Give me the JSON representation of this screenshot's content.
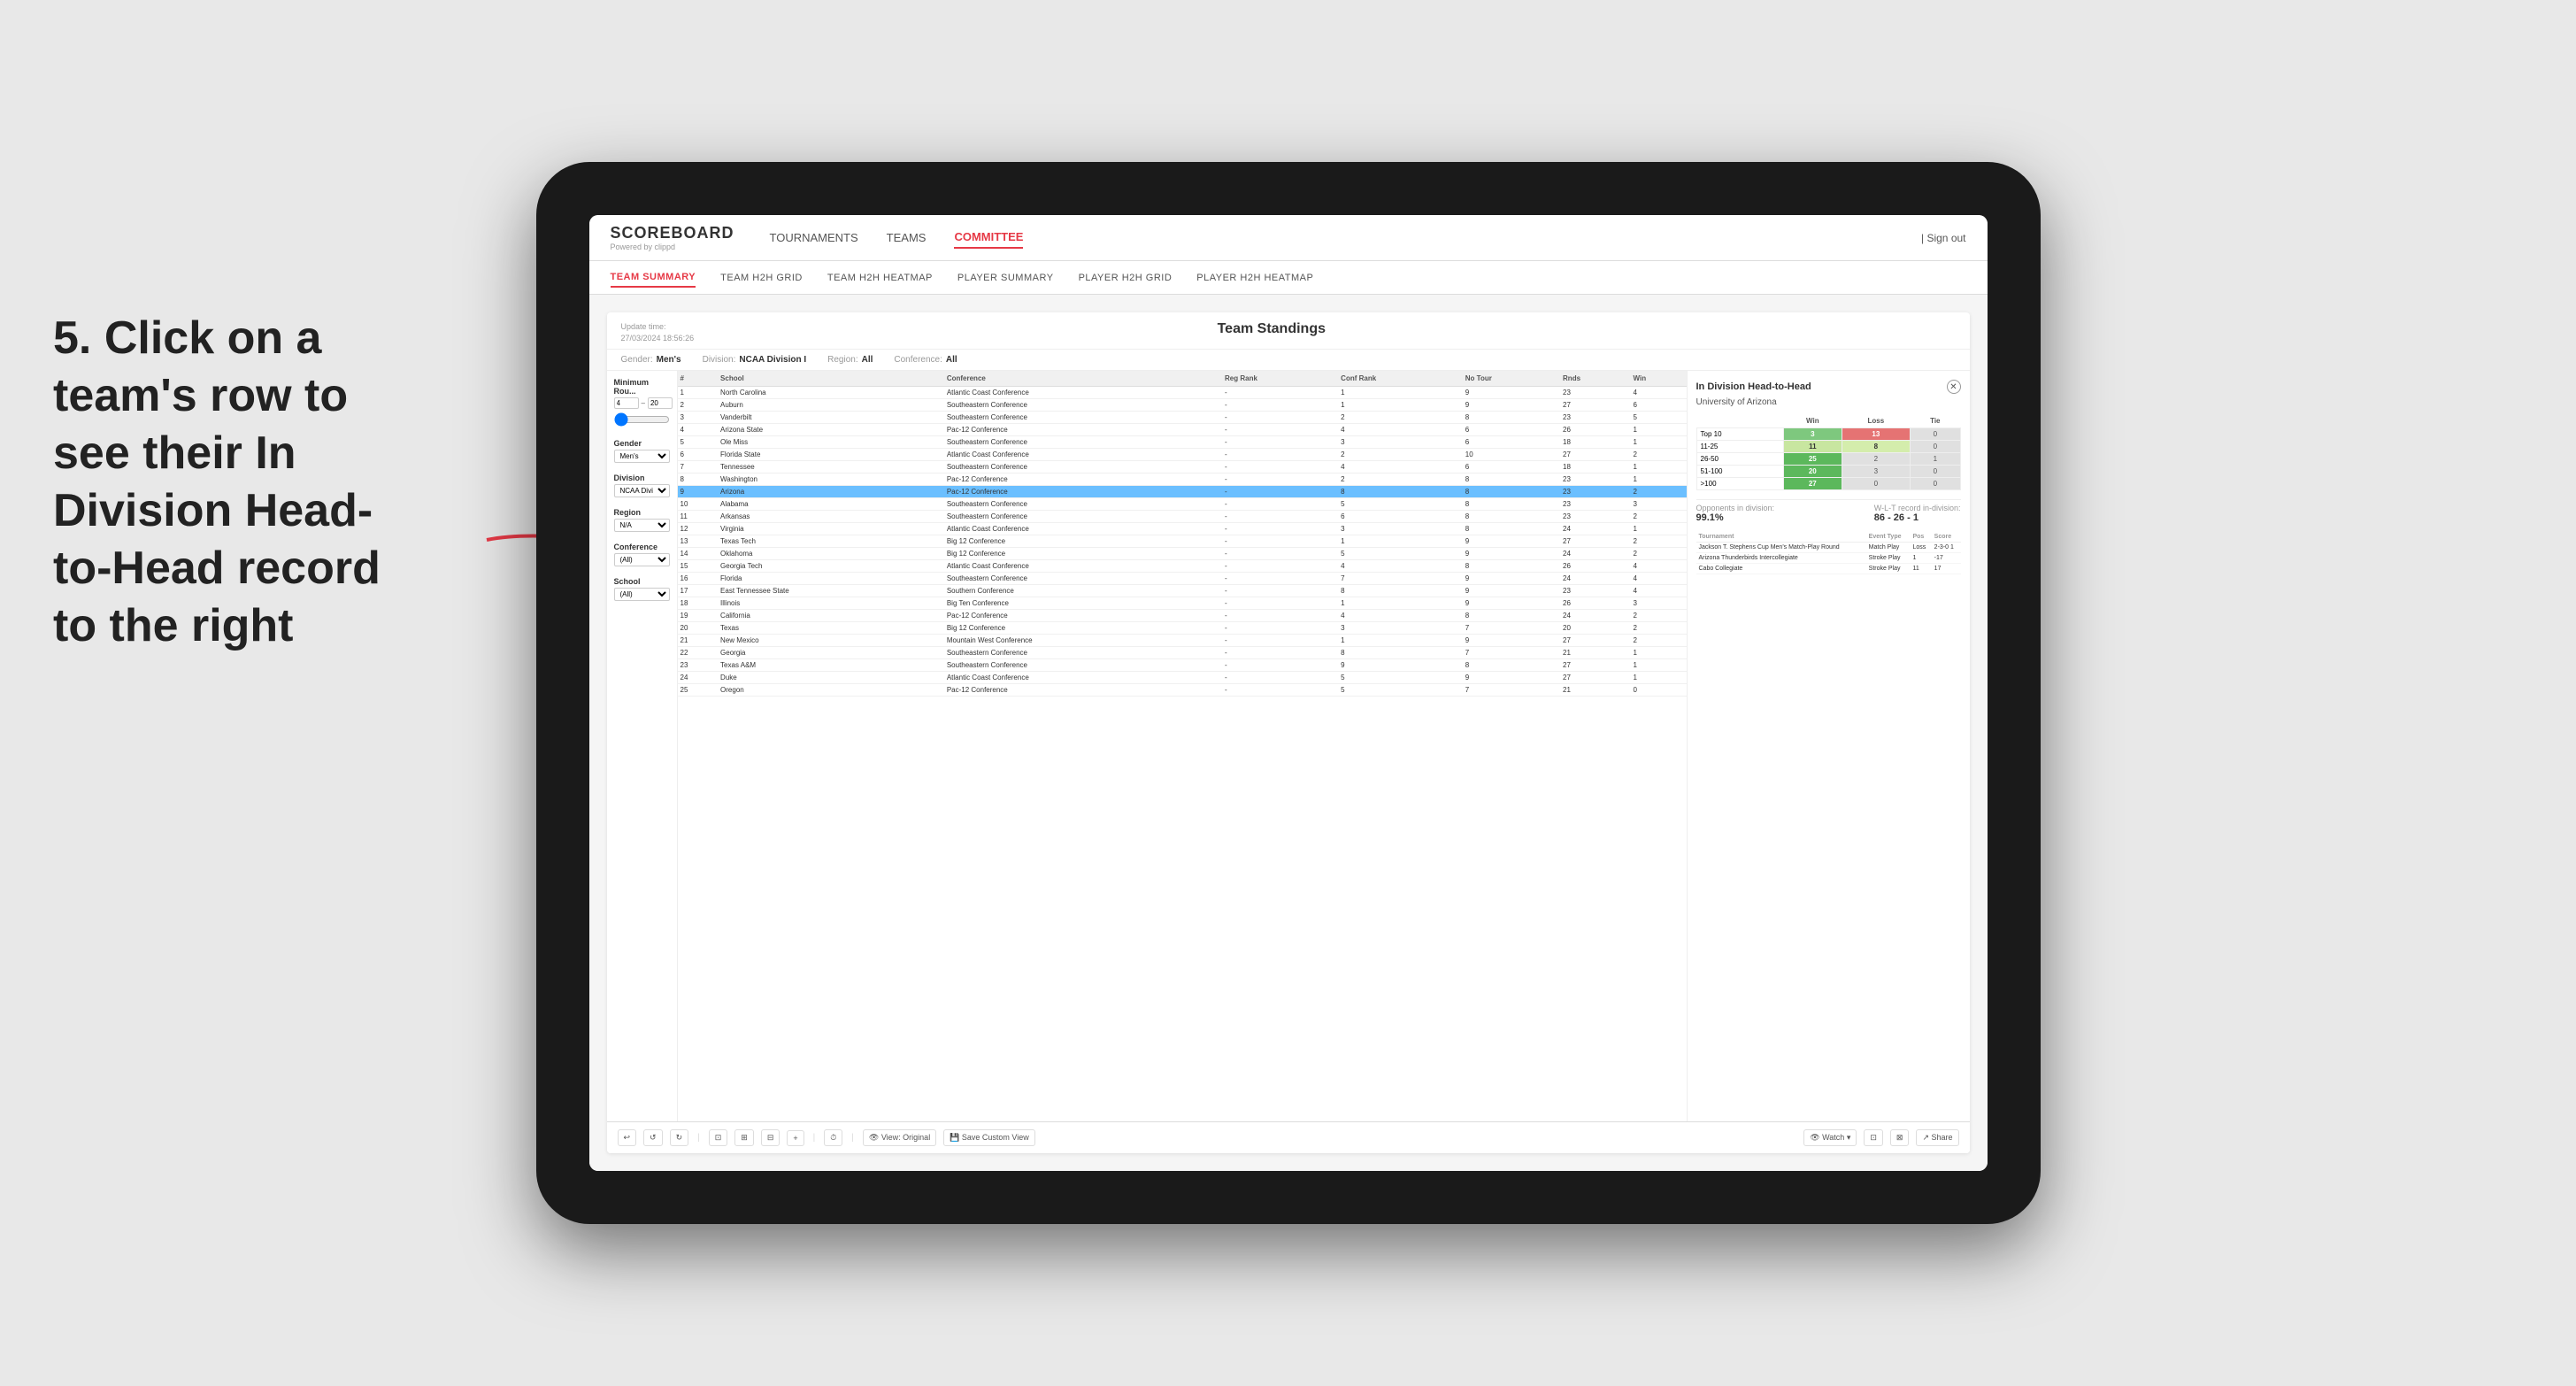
{
  "instruction": {
    "step": "5.",
    "text": "Click on a team's row to see their In Division Head-to-Head record to the right"
  },
  "nav": {
    "logo": "SCOREBOARD",
    "logo_sub": "Powered by clippd",
    "links": [
      "TOURNAMENTS",
      "TEAMS",
      "COMMITTEE"
    ],
    "active_link": "COMMITTEE",
    "sign_out": "Sign out"
  },
  "sub_nav": {
    "links": [
      "TEAM SUMMARY",
      "TEAM H2H GRID",
      "TEAM H2H HEATMAP",
      "PLAYER SUMMARY",
      "PLAYER H2H GRID",
      "PLAYER H2H HEATMAP"
    ],
    "active_link": "TEAM SUMMARY"
  },
  "panel": {
    "update_time": "Update time:\n27/03/2024 18:56:26",
    "title": "Team Standings",
    "filters": {
      "gender_label": "Gender:",
      "gender_value": "Men's",
      "division_label": "Division:",
      "division_value": "NCAA Division I",
      "region_label": "Region:",
      "region_value": "All",
      "conference_label": "Conference:",
      "conference_value": "All"
    }
  },
  "left_filters": {
    "min_rounds_label": "Minimum Rou...",
    "min_rounds_value": "4",
    "max_rounds_value": "20",
    "gender_label": "Gender",
    "gender_options": [
      "Men's"
    ],
    "division_label": "Division",
    "division_options": [
      "NCAA Division I"
    ],
    "region_label": "Region",
    "region_options": [
      "N/A"
    ],
    "conference_label": "Conference",
    "conference_options": [
      "(All)"
    ],
    "school_label": "School",
    "school_options": [
      "(All)"
    ]
  },
  "table": {
    "headers": [
      "#",
      "School",
      "Conference",
      "Reg Rank",
      "Conf Rank",
      "No Tour",
      "Rnds",
      "Win"
    ],
    "rows": [
      {
        "rank": 1,
        "school": "North Carolina",
        "conference": "Atlantic Coast Conference",
        "reg": "-",
        "conf": "1",
        "tour": "9",
        "rnds": "23",
        "win": "4",
        "highlighted": false
      },
      {
        "rank": 2,
        "school": "Auburn",
        "conference": "Southeastern Conference",
        "reg": "-",
        "conf": "1",
        "tour": "9",
        "rnds": "27",
        "win": "6",
        "highlighted": false
      },
      {
        "rank": 3,
        "school": "Vanderbilt",
        "conference": "Southeastern Conference",
        "reg": "-",
        "conf": "2",
        "tour": "8",
        "rnds": "23",
        "win": "5",
        "highlighted": false
      },
      {
        "rank": 4,
        "school": "Arizona State",
        "conference": "Pac-12 Conference",
        "reg": "-",
        "conf": "4",
        "tour": "6",
        "rnds": "26",
        "win": "1",
        "highlighted": false
      },
      {
        "rank": 5,
        "school": "Ole Miss",
        "conference": "Southeastern Conference",
        "reg": "-",
        "conf": "3",
        "tour": "6",
        "rnds": "18",
        "win": "1",
        "highlighted": false
      },
      {
        "rank": 6,
        "school": "Florida State",
        "conference": "Atlantic Coast Conference",
        "reg": "-",
        "conf": "2",
        "tour": "10",
        "rnds": "27",
        "win": "2",
        "highlighted": false
      },
      {
        "rank": 7,
        "school": "Tennessee",
        "conference": "Southeastern Conference",
        "reg": "-",
        "conf": "4",
        "tour": "6",
        "rnds": "18",
        "win": "1",
        "highlighted": false
      },
      {
        "rank": 8,
        "school": "Washington",
        "conference": "Pac-12 Conference",
        "reg": "-",
        "conf": "2",
        "tour": "8",
        "rnds": "23",
        "win": "1",
        "highlighted": false
      },
      {
        "rank": 9,
        "school": "Arizona",
        "conference": "Pac-12 Conference",
        "reg": "-",
        "conf": "8",
        "tour": "8",
        "rnds": "23",
        "win": "2",
        "highlighted": true
      },
      {
        "rank": 10,
        "school": "Alabama",
        "conference": "Southeastern Conference",
        "reg": "-",
        "conf": "5",
        "tour": "8",
        "rnds": "23",
        "win": "3",
        "highlighted": false
      },
      {
        "rank": 11,
        "school": "Arkansas",
        "conference": "Southeastern Conference",
        "reg": "-",
        "conf": "6",
        "tour": "8",
        "rnds": "23",
        "win": "2",
        "highlighted": false
      },
      {
        "rank": 12,
        "school": "Virginia",
        "conference": "Atlantic Coast Conference",
        "reg": "-",
        "conf": "3",
        "tour": "8",
        "rnds": "24",
        "win": "1",
        "highlighted": false
      },
      {
        "rank": 13,
        "school": "Texas Tech",
        "conference": "Big 12 Conference",
        "reg": "-",
        "conf": "1",
        "tour": "9",
        "rnds": "27",
        "win": "2",
        "highlighted": false
      },
      {
        "rank": 14,
        "school": "Oklahoma",
        "conference": "Big 12 Conference",
        "reg": "-",
        "conf": "5",
        "tour": "9",
        "rnds": "24",
        "win": "2",
        "highlighted": false
      },
      {
        "rank": 15,
        "school": "Georgia Tech",
        "conference": "Atlantic Coast Conference",
        "reg": "-",
        "conf": "4",
        "tour": "8",
        "rnds": "26",
        "win": "4",
        "highlighted": false
      },
      {
        "rank": 16,
        "school": "Florida",
        "conference": "Southeastern Conference",
        "reg": "-",
        "conf": "7",
        "tour": "9",
        "rnds": "24",
        "win": "4",
        "highlighted": false
      },
      {
        "rank": 17,
        "school": "East Tennessee State",
        "conference": "Southern Conference",
        "reg": "-",
        "conf": "8",
        "tour": "9",
        "rnds": "23",
        "win": "4",
        "highlighted": false
      },
      {
        "rank": 18,
        "school": "Illinois",
        "conference": "Big Ten Conference",
        "reg": "-",
        "conf": "1",
        "tour": "9",
        "rnds": "26",
        "win": "3",
        "highlighted": false
      },
      {
        "rank": 19,
        "school": "California",
        "conference": "Pac-12 Conference",
        "reg": "-",
        "conf": "4",
        "tour": "8",
        "rnds": "24",
        "win": "2",
        "highlighted": false
      },
      {
        "rank": 20,
        "school": "Texas",
        "conference": "Big 12 Conference",
        "reg": "-",
        "conf": "3",
        "tour": "7",
        "rnds": "20",
        "win": "2",
        "highlighted": false
      },
      {
        "rank": 21,
        "school": "New Mexico",
        "conference": "Mountain West Conference",
        "reg": "-",
        "conf": "1",
        "tour": "9",
        "rnds": "27",
        "win": "2",
        "highlighted": false
      },
      {
        "rank": 22,
        "school": "Georgia",
        "conference": "Southeastern Conference",
        "reg": "-",
        "conf": "8",
        "tour": "7",
        "rnds": "21",
        "win": "1",
        "highlighted": false
      },
      {
        "rank": 23,
        "school": "Texas A&M",
        "conference": "Southeastern Conference",
        "reg": "-",
        "conf": "9",
        "tour": "8",
        "rnds": "27",
        "win": "1",
        "highlighted": false
      },
      {
        "rank": 24,
        "school": "Duke",
        "conference": "Atlantic Coast Conference",
        "reg": "-",
        "conf": "5",
        "tour": "9",
        "rnds": "27",
        "win": "1",
        "highlighted": false
      },
      {
        "rank": 25,
        "school": "Oregon",
        "conference": "Pac-12 Conference",
        "reg": "-",
        "conf": "5",
        "tour": "7",
        "rnds": "21",
        "win": "0",
        "highlighted": false
      }
    ]
  },
  "h2h_panel": {
    "title": "In Division Head-to-Head",
    "team": "University of Arizona",
    "table_headers": [
      "",
      "Win",
      "Loss",
      "Tie"
    ],
    "rows": [
      {
        "range": "Top 10",
        "win": 3,
        "loss": 13,
        "tie": 0,
        "win_color": "green",
        "loss_color": "red"
      },
      {
        "range": "11-25",
        "win": 11,
        "loss": 8,
        "tie": 0,
        "win_color": "yellow",
        "loss_color": "lightyellow"
      },
      {
        "range": "26-50",
        "win": 25,
        "loss": 2,
        "tie": 1,
        "win_color": "darkgreen",
        "loss_color": "gray"
      },
      {
        "range": "51-100",
        "win": 20,
        "loss": 3,
        "tie": 0,
        "win_color": "darkgreen",
        "loss_color": "gray"
      },
      {
        "range": ">100",
        "win": 27,
        "loss": 0,
        "tie": 0,
        "win_color": "darkgreen",
        "loss_color": "gray"
      }
    ],
    "opponents_label": "Opponents in division:",
    "opponents_value": "99.1%",
    "record_label": "W-L-T record in-division:",
    "record_value": "86 - 26 - 1",
    "tournament_label": "Tournament",
    "tournament_headers": [
      "Tournament",
      "Event Type",
      "Pos",
      "Score"
    ],
    "tournaments": [
      {
        "name": "Jackson T. Stephens Cup Men's Match-Play Round",
        "type": "Match Play",
        "pos": "Loss",
        "score": "2-3-0 1"
      },
      {
        "name": "Arizona Thunderbirds Intercollegiate",
        "type": "Stroke Play",
        "pos": "1",
        "score": "-17"
      },
      {
        "name": "Cabo Collegiate",
        "type": "Stroke Play",
        "pos": "11",
        "score": "17"
      }
    ]
  },
  "toolbar": {
    "buttons": [
      "↩",
      "↺",
      "↻",
      "⊡",
      "⊞",
      "⊟",
      "+",
      "⏱",
      "View: Original",
      "Save Custom View"
    ],
    "right_buttons": [
      "👁 Watch",
      "⊡",
      "⊠",
      "Share"
    ]
  }
}
